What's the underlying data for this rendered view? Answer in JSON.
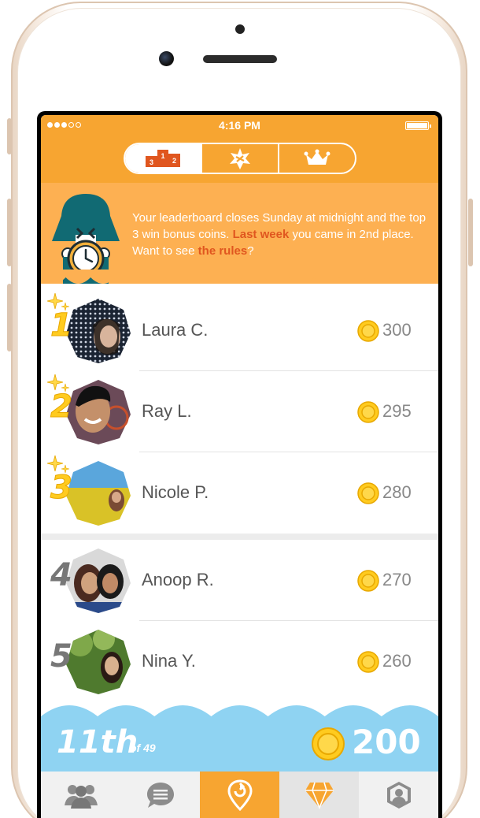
{
  "status_bar": {
    "time": "4:16 PM"
  },
  "header": {
    "tabs": [
      {
        "id": "podium",
        "icon": "podium-icon",
        "podium_labels": [
          "3",
          "1",
          "2"
        ],
        "active": true
      },
      {
        "id": "badges",
        "icon": "star-badge-icon",
        "active": false
      },
      {
        "id": "crown",
        "icon": "crown-icon",
        "active": false
      }
    ]
  },
  "banner": {
    "text_part1": "Your leaderboard closes Sunday at midnight and the top 3 win bonus coins. ",
    "link_last_week": "Last week",
    "text_part2": " you came in 2nd place. Want to see ",
    "link_rules": "the rules",
    "text_part3": "?",
    "mascot_icon": "alarm-clock-mascot-icon"
  },
  "leaderboard": [
    {
      "rank": "1",
      "name": "Laura C.",
      "score": "300",
      "top": true
    },
    {
      "rank": "2",
      "name": "Ray L.",
      "score": "295",
      "top": true
    },
    {
      "rank": "3",
      "name": "Nicole P.",
      "score": "280",
      "top": true
    },
    {
      "rank": "4",
      "name": "Anoop R.",
      "score": "270",
      "top": false
    },
    {
      "rank": "5",
      "name": "Nina Y.",
      "score": "260",
      "top": false
    }
  ],
  "my_standing": {
    "rank": "11th",
    "of_total": "of 49",
    "coins": "200"
  },
  "tabbar": {
    "items": [
      {
        "icon": "people-icon",
        "active": false
      },
      {
        "icon": "chat-bubble-icon",
        "active": false
      },
      {
        "icon": "location-pin-icon",
        "active": true
      },
      {
        "icon": "diamond-icon",
        "active": false
      },
      {
        "icon": "profile-icon",
        "active": false
      }
    ]
  },
  "colors": {
    "brand_orange": "#f7a531",
    "banner_orange": "#fdb052",
    "link_red_orange": "#e0561f",
    "gold": "#ffcb1f",
    "sky_blue": "#8fd3f2"
  }
}
